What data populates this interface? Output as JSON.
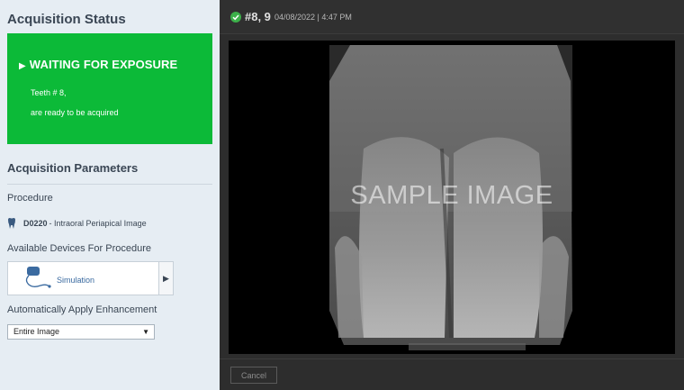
{
  "left_panel": {
    "acquisition_status_heading": "Acquisition Status",
    "status": {
      "title": "WAITING FOR EXPOSURE",
      "line1": "Teeth # 8,",
      "line2": "are ready to be acquired",
      "color": "#0cba38"
    },
    "acquisition_params_heading": "Acquisition Parameters",
    "procedure_label": "Procedure",
    "procedure": {
      "code": "D0220",
      "description": " - Intraoral Periapical Image"
    },
    "devices_label": "Available Devices For Procedure",
    "device": {
      "name": "Simulation",
      "icon": "sensor-icon"
    },
    "enhancement_label": "Automatically Apply Enhancement",
    "enhancement_value": "Entire Image"
  },
  "right_panel": {
    "header": {
      "teeth": "#8, 9",
      "timestamp": "04/08/2022 | 4:47 PM",
      "status_icon": "check-circle-icon"
    },
    "image_watermark": "SAMPLE IMAGE",
    "cancel_label": "Cancel"
  }
}
